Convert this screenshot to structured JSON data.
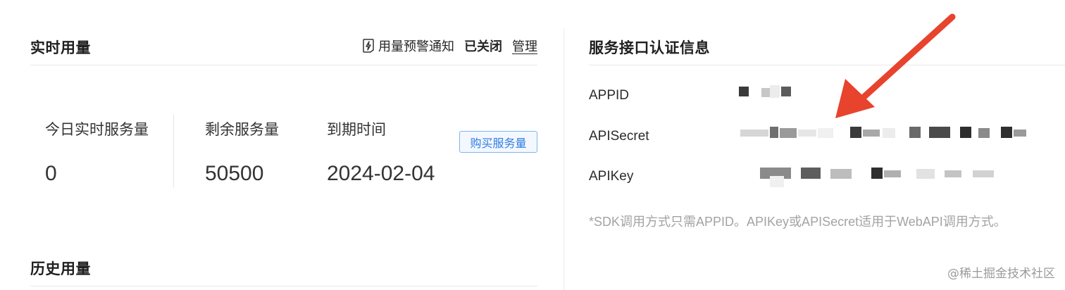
{
  "realtime": {
    "title": "实时用量",
    "alert_label": "用量预警通知",
    "alert_status": "已关闭",
    "manage_label": "管理",
    "stats": [
      {
        "label": "今日实时服务量",
        "value": "0"
      },
      {
        "label": "剩余服务量",
        "value": "50500"
      },
      {
        "label": "到期时间",
        "value": "2024-02-04"
      }
    ],
    "buy_button": "购买服务量"
  },
  "history": {
    "title": "历史用量"
  },
  "auth": {
    "title": "服务接口认证信息",
    "rows": [
      {
        "label": "APPID"
      },
      {
        "label": "APISecret"
      },
      {
        "label": "APIKey"
      }
    ],
    "note": "*SDK调用方式只需APPID。APIKey或APISecret适用于WebAPI调用方式。"
  },
  "watermark": "@稀土掘金技术社区",
  "colors": {
    "accent": "#2f7de1",
    "arrow": "#e8432d"
  },
  "icons": {
    "alert": "lightning-bolt-icon",
    "annotation": "red-arrow"
  }
}
